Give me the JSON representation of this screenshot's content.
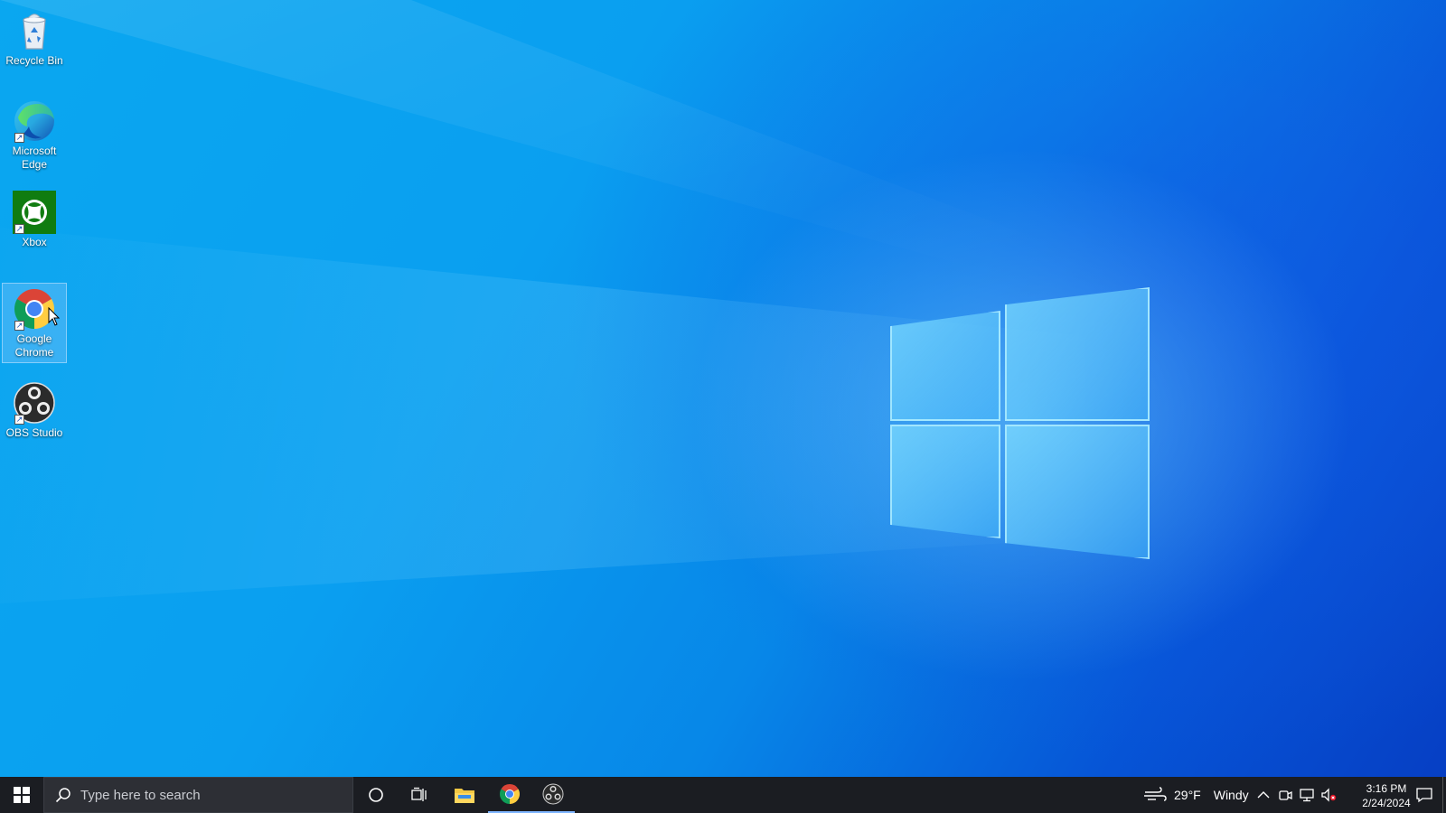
{
  "desktop": {
    "icons": [
      {
        "label_line1": "Recycle Bin",
        "label_line2": "",
        "icon": "recycle-bin-icon"
      },
      {
        "label_line1": "Microsoft",
        "label_line2": "Edge",
        "icon": "edge-icon"
      },
      {
        "label_line1": "Xbox",
        "label_line2": "",
        "icon": "xbox-icon"
      },
      {
        "label_line1": "Google",
        "label_line2": "Chrome",
        "icon": "chrome-icon"
      },
      {
        "label_line1": "OBS Studio",
        "label_line2": "",
        "icon": "obs-icon"
      }
    ],
    "selected_icon": "Google Chrome"
  },
  "taskbar": {
    "search_placeholder": "Type here to search",
    "pinned": [
      "file-explorer-icon",
      "chrome-icon",
      "obs-icon"
    ],
    "weather": {
      "temperature": "29°F",
      "condition": "Windy"
    },
    "clock": {
      "time": "3:16 PM",
      "date": "2/24/2024"
    },
    "tray_icons": [
      "chevron-up-icon",
      "meet-now-icon",
      "network-icon",
      "volume-muted-icon"
    ]
  },
  "colors": {
    "taskbar_bg": "#1b1d22",
    "search_bg": "#2d2f35",
    "wallpaper_primary": "#0a9ff0",
    "wallpaper_dark": "#063fc4"
  }
}
